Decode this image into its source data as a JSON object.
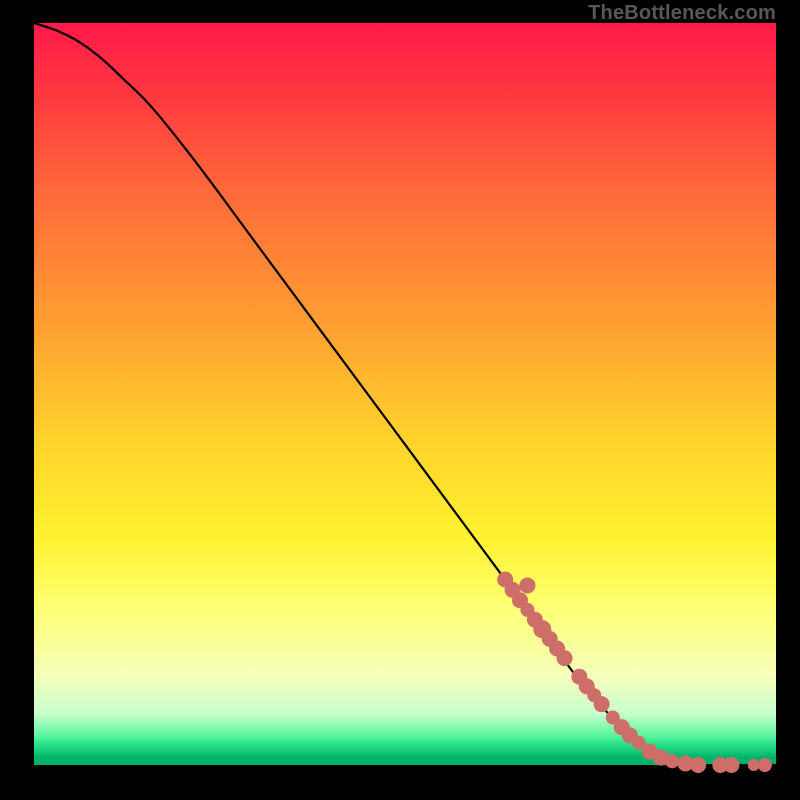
{
  "watermark": "TheBottleneck.com",
  "colors": {
    "point_fill": "#cd6f68",
    "curve_stroke": "#000000"
  },
  "chart_data": {
    "type": "line",
    "title": "",
    "xlabel": "",
    "ylabel": "",
    "xlim": [
      0,
      100
    ],
    "ylim": [
      0,
      100
    ],
    "grid": false,
    "legend": false,
    "curve_comment": "Monotone decreasing curve from top-left to bottom-right; starts ~100, gentle concave start, near-linear middle, levels out at 0 around x≈88, flat to 100.",
    "curve": {
      "x": [
        0,
        3,
        6,
        9,
        12,
        16,
        22,
        30,
        40,
        50,
        60,
        68,
        74,
        80,
        84,
        88,
        92,
        96,
        100
      ],
      "y": [
        100,
        99,
        97.5,
        95.3,
        92.5,
        88.5,
        81,
        70.2,
        56.7,
        43.2,
        29.7,
        18.9,
        10.8,
        4.3,
        1.3,
        0,
        0,
        0,
        0
      ]
    },
    "scatter_comment": "Salmon-colored points concentrated along the lower-right tail of the curve.",
    "scatter": {
      "x": [
        63.5,
        64.5,
        65.5,
        66.5,
        66.5,
        67.5,
        68.5,
        69.5,
        70.5,
        71.5,
        73.5,
        74.5,
        75.5,
        76.5,
        78.0,
        79.2,
        80.3,
        81.5,
        83.0,
        84.5,
        86.0,
        87.8,
        89.5,
        92.5,
        94.0,
        97.0,
        98.5
      ],
      "y": [
        25.0,
        23.6,
        22.2,
        20.9,
        24.2,
        19.6,
        18.3,
        17.0,
        15.7,
        14.4,
        11.9,
        10.6,
        9.4,
        8.2,
        6.4,
        5.1,
        4.0,
        3.0,
        1.8,
        1.0,
        0.5,
        0.2,
        0.0,
        0.0,
        0.0,
        0.0,
        0.0
      ],
      "r": [
        8,
        8,
        8,
        7,
        8,
        8,
        9,
        8,
        8,
        8,
        8,
        8,
        7,
        8,
        7,
        8,
        8,
        7,
        8,
        8,
        7,
        8,
        8,
        8,
        8,
        6,
        7
      ]
    }
  }
}
